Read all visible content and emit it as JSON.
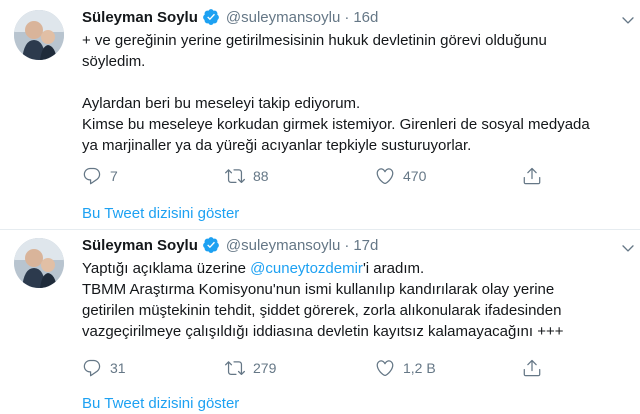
{
  "tweets": [
    {
      "name": "Süleyman Soylu",
      "handle": "@suleymansoylu",
      "separator": "·",
      "time": "16d",
      "lines": [
        "+ ve gereğinin yerine getirilmesisinin hukuk devletinin görevi olduğunu",
        "söyledim.",
        "",
        "Aylardan beri bu meseleyi takip ediyorum.",
        "Kimse bu meseleye korkudan girmek istemiyor. Girenleri de sosyal medyada",
        "ya marjinaller ya da yüreği acıyanlar tepkiyle susturuyorlar."
      ],
      "replies": "7",
      "retweets": "88",
      "likes": "470",
      "thread_link": "Bu Tweet dizisini göster"
    },
    {
      "name": "Süleyman Soylu",
      "handle": "@suleymansoylu",
      "separator": "·",
      "time": "17d",
      "line1_pre": "Yaptığı açıklama üzerine ",
      "mention": "@cuneytozdemir",
      "line1_post": "'i aradım.",
      "lines": [
        "TBMM Araştırma Komisyonu'nun ismi kullanılıp kandırılarak olay yerine",
        "getirilen müştekinin tehdit, şiddet görerek, zorla alıkonularak ifadesinden",
        "vazgeçirilmeye çalışıldığı iddiasına devletin kayıtsız kalamayacağını +++"
      ],
      "replies": "31",
      "retweets": "279",
      "likes": "1,2 B",
      "thread_link": "Bu Tweet dizisini göster"
    }
  ],
  "colors": {
    "accent": "#1da1f2",
    "secondary_text": "#657786",
    "divider": "#e6ecf0"
  },
  "icons": [
    "verified-badge-icon",
    "chevron-down-icon",
    "reply-icon",
    "retweet-icon",
    "like-icon",
    "share-icon"
  ]
}
